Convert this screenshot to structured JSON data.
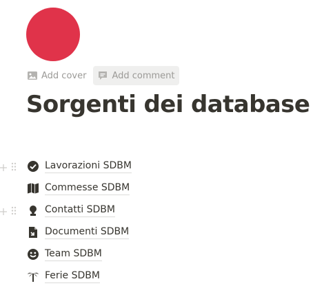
{
  "page": {
    "icon_color": "#e0334a",
    "actions": {
      "add_cover": "Add cover",
      "add_comment": "Add comment"
    },
    "title": "Sorgenti dei database"
  },
  "databases": [
    {
      "label": "Lavorazioni SDBM",
      "icon": "check-circle-icon",
      "handles_visible": true
    },
    {
      "label": "Commesse SDBM",
      "icon": "map-icon",
      "handles_visible": false
    },
    {
      "label": "Contatti SDBM",
      "icon": "person-bust-icon",
      "handles_visible": true
    },
    {
      "label": "Documenti SDBM",
      "icon": "document-icon",
      "handles_visible": false
    },
    {
      "label": "Team SDBM",
      "icon": "smiley-icon",
      "handles_visible": false
    },
    {
      "label": "Ferie SDBM",
      "icon": "palm-tree-icon",
      "handles_visible": false
    }
  ]
}
